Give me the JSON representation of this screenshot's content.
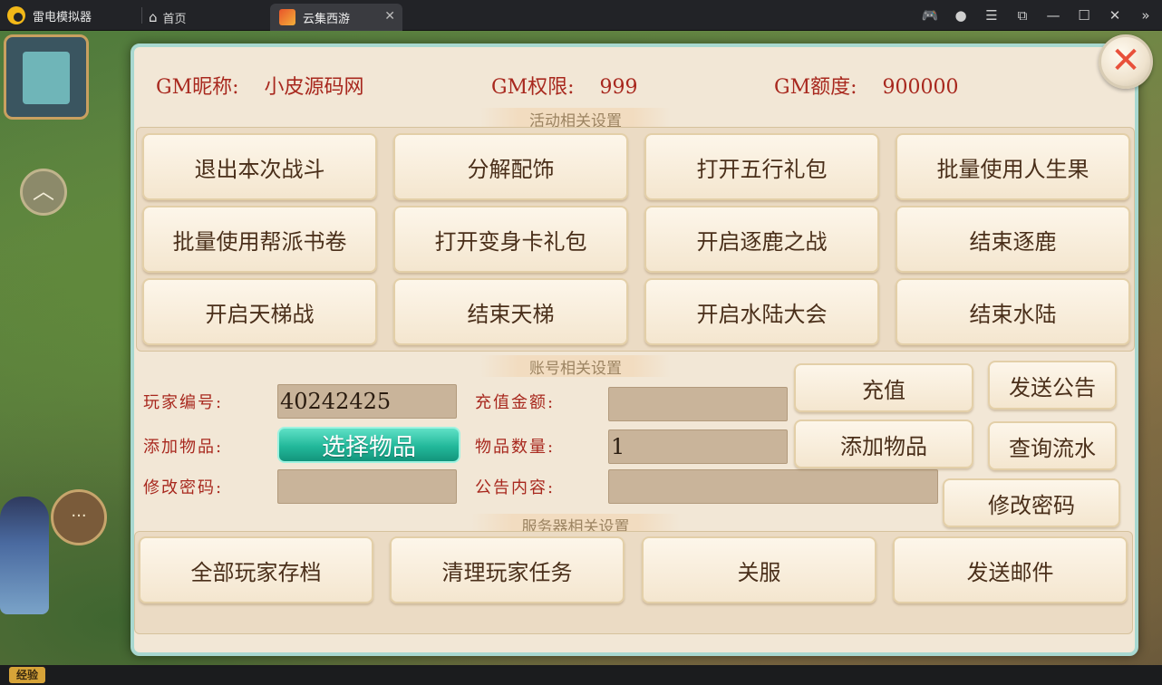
{
  "emulator": {
    "app_name": "雷电模拟器",
    "tabs": [
      {
        "label": "首页"
      },
      {
        "label": "云集西游"
      }
    ]
  },
  "game": {
    "exp_label": "经验"
  },
  "gm": {
    "nickname_label": "GM昵称:",
    "nickname": "小皮源码网",
    "permission_label": "GM权限:",
    "permission": "999",
    "quota_label": "GM额度:",
    "quota": "900000"
  },
  "activity": {
    "title": "活动相关设置",
    "buttons": [
      "退出本次战斗",
      "分解配饰",
      "打开五行礼包",
      "批量使用人生果",
      "批量使用帮派书卷",
      "打开变身卡礼包",
      "开启逐鹿之战",
      "结束逐鹿",
      "开启天梯战",
      "结束天梯",
      "开启水陆大会",
      "结束水陆"
    ]
  },
  "account": {
    "title": "账号相关设置",
    "player_id_label": "玩家编号:",
    "player_id": "40242425",
    "add_item_label": "添加物品:",
    "select_item_button": "选择物品",
    "change_pwd_label": "修改密码:",
    "change_pwd_value": "",
    "recharge_label": "充值金额:",
    "recharge_value": "",
    "item_count_label": "物品数量:",
    "item_count": "1",
    "notice_label": "公告内容:",
    "notice_value": "",
    "recharge_button": "充值",
    "add_item_button": "添加物品",
    "send_notice_button": "发送公告",
    "query_flow_button": "查询流水",
    "change_pwd_button": "修改密码"
  },
  "server": {
    "title": "服务器相关设置",
    "buttons": [
      "全部玩家存档",
      "清理玩家任务",
      "关服",
      "发送邮件"
    ]
  }
}
